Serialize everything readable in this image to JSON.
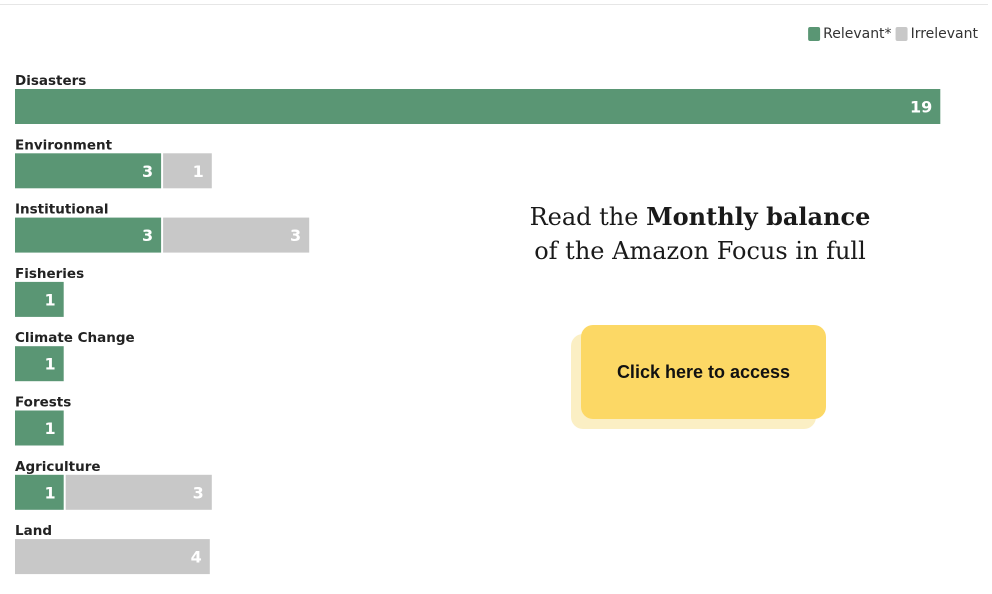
{
  "chart_data": {
    "type": "bar",
    "orientation": "horizontal",
    "stacked": true,
    "categories": [
      "Disasters",
      "Environment",
      "Institutional",
      "Fisheries",
      "Climate Change",
      "Forests",
      "Agriculture",
      "Land"
    ],
    "series": [
      {
        "name": "Relevant*",
        "values": [
          19,
          3,
          3,
          1,
          1,
          1,
          1,
          0
        ]
      },
      {
        "name": "Irrelevant",
        "values": [
          0,
          1,
          3,
          0,
          0,
          0,
          3,
          4
        ]
      }
    ],
    "legend_position": "top-right",
    "grid": false,
    "title": "",
    "xlabel": "",
    "ylabel": ""
  },
  "colors": {
    "relevant": "#5a9674",
    "irrelevant": "#c8c8c8",
    "button": "#fcd865",
    "button_shadow": "#fbefc4"
  },
  "promo": {
    "text_before": "Read the",
    "bold_text": "Monthly balance",
    "text_after": "of the Amazon Focus in full"
  },
  "cta": {
    "label": "Click here to access"
  }
}
